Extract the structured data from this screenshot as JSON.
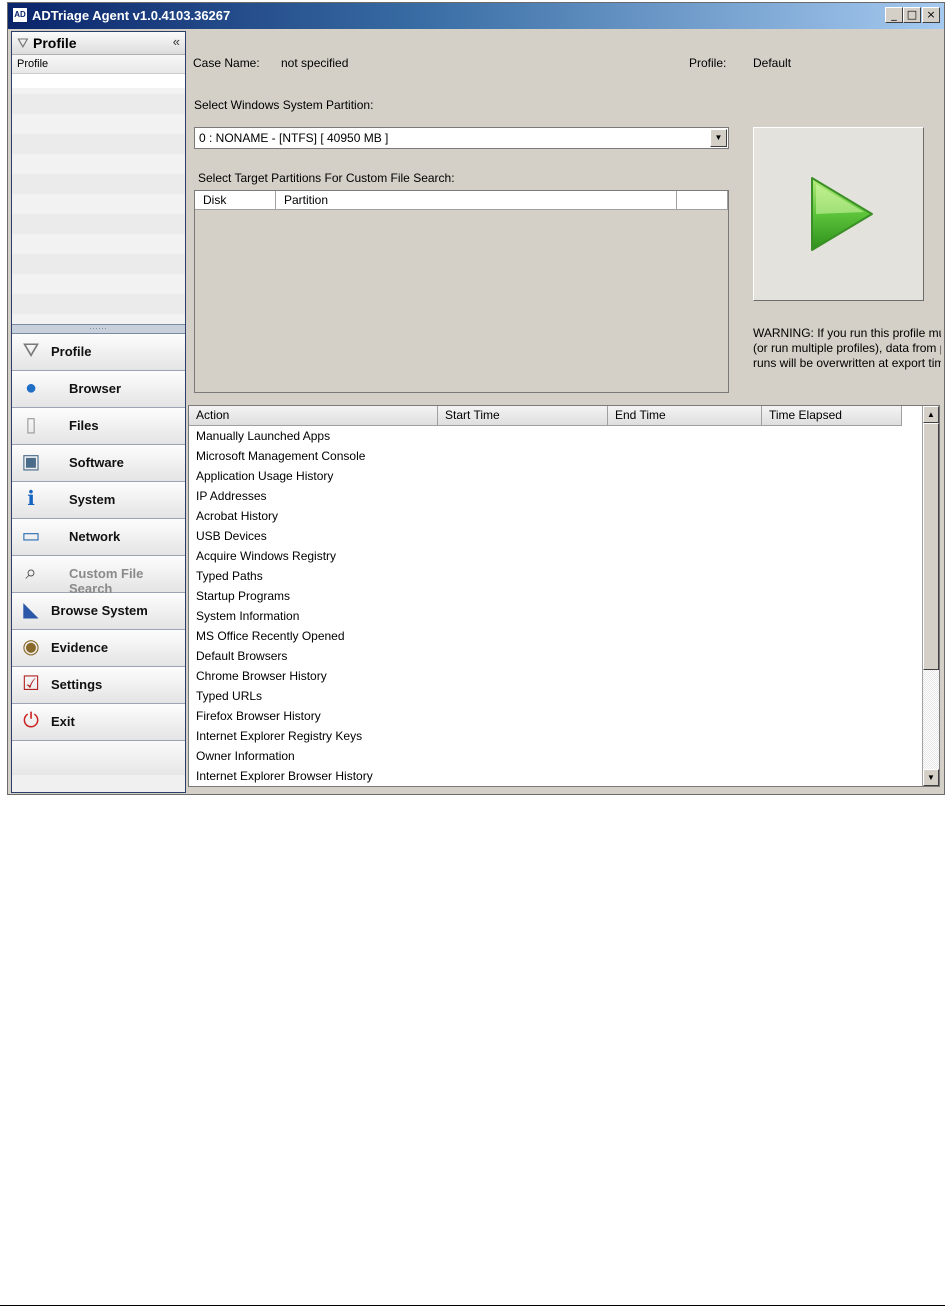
{
  "window": {
    "title": "ADTriage Agent v1.0.4103.36267",
    "icon_text": "AD",
    "controls": {
      "minimize": "_",
      "maximize": "□",
      "close": "×"
    }
  },
  "sidebar": {
    "header_title": "Profile",
    "collapse_glyph": "«",
    "sub_label": "Profile",
    "grip": "......",
    "items": [
      {
        "label": "Profile",
        "icon": "funnel-icon",
        "glyph": "⛛",
        "color": "#7a7a7a",
        "disabled": false
      },
      {
        "label": "Browser",
        "icon": "globe-icon",
        "glyph": "●",
        "color": "#1f6fc7",
        "disabled": false
      },
      {
        "label": "Files",
        "icon": "file-icon",
        "glyph": "▯",
        "color": "#9a9a9a",
        "disabled": false
      },
      {
        "label": "Software",
        "icon": "software-box-icon",
        "glyph": "▣",
        "color": "#4a6b8a",
        "disabled": false
      },
      {
        "label": "System",
        "icon": "info-icon",
        "glyph": "ℹ",
        "color": "#1565c0",
        "disabled": false
      },
      {
        "label": "Network",
        "icon": "monitor-icon",
        "glyph": "▭",
        "color": "#2c6fb5",
        "disabled": false
      },
      {
        "label": "Custom File Search",
        "icon": "magnifier-icon",
        "glyph": "⌕",
        "color": "#555555",
        "disabled": true
      },
      {
        "label": "Browse System",
        "icon": "browse-system-icon",
        "glyph": "◣",
        "color": "#2b57a8",
        "disabled": false
      },
      {
        "label": "Evidence",
        "icon": "evidence-icon",
        "glyph": "◉",
        "color": "#8a6a2a",
        "disabled": false
      },
      {
        "label": "Settings",
        "icon": "settings-checklist-icon",
        "glyph": "☑",
        "color": "#b22222",
        "disabled": false
      },
      {
        "label": "Exit",
        "icon": "power-icon",
        "glyph": "⏻",
        "color": "#cc2020",
        "disabled": false
      }
    ]
  },
  "main": {
    "case_name_label": "Case Name:",
    "case_name_value": "not specified",
    "profile_label": "Profile:",
    "profile_value": "Default",
    "partition_label": "Select Windows System Partition:",
    "partition_selected": "0 : NONAME - [NTFS] [ 40950 MB ]",
    "targets_label": "Select Target Partitions For Custom File Search:",
    "targets_columns": [
      "Disk",
      "Partition",
      ""
    ],
    "warning_lines": [
      "WARNING: If you run this profile mult",
      "(or run multiple profiles), data from pre",
      "runs will be overwritten at export time"
    ]
  },
  "actions": {
    "columns": [
      "Action",
      "Start Time",
      "End Time",
      "Time Elapsed"
    ],
    "rows": [
      "Manually Launched Apps",
      "Microsoft Management Console",
      "Application Usage History",
      "IP Addresses",
      "Acrobat History",
      "USB Devices",
      "Acquire Windows Registry",
      "Typed Paths",
      "Startup Programs",
      "System Information",
      "MS Office Recently Opened",
      "Default Browsers",
      "Chrome Browser History",
      "Typed URLs",
      "Firefox Browser History",
      "Internet Explorer Registry Keys",
      "Owner Information",
      "Internet Explorer Browser History"
    ],
    "scroll_up": "▲",
    "scroll_down": "▼"
  }
}
